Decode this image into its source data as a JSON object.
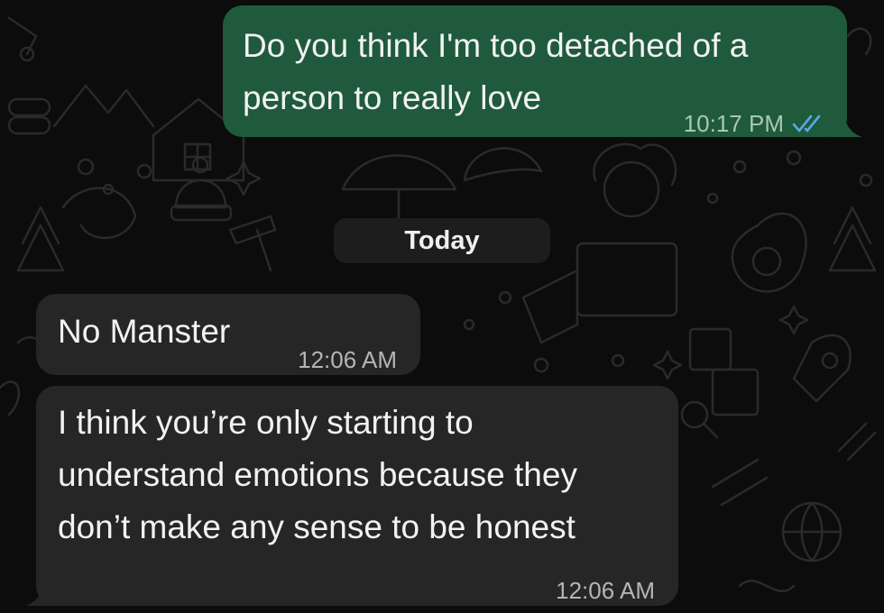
{
  "date_divider": "Today",
  "messages": [
    {
      "direction": "outgoing",
      "text": "Do you think I'm too detached of a\nperson to really love",
      "time": "10:17 PM",
      "status_icon": "double-check-read-icon"
    },
    {
      "direction": "incoming",
      "text": "No Manster",
      "time": "12:06 AM"
    },
    {
      "direction": "incoming",
      "text": "I think you’re only starting to\nunderstand emotions because they\ndon’t make any sense to be honest",
      "time": "12:06 AM"
    }
  ],
  "colors": {
    "outgoing_bubble": "#1f5a3c",
    "incoming_bubble": "#262626",
    "background": "#0c0c0c",
    "read_tick": "#5aa8e6"
  }
}
